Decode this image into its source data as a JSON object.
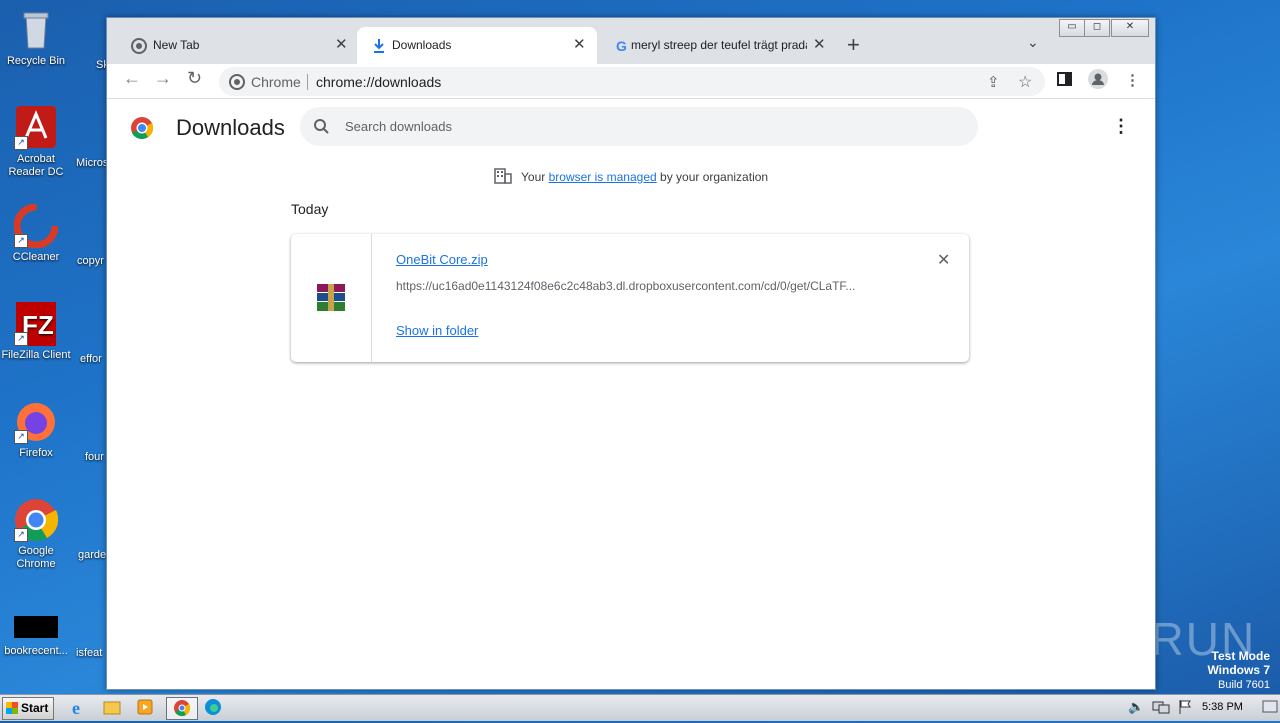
{
  "desktop": {
    "icons": [
      {
        "label": "Recycle Bin"
      },
      {
        "label": "Acrobat Reader DC"
      },
      {
        "label": "CCleaner"
      },
      {
        "label": "FileZilla Client"
      },
      {
        "label": "Firefox"
      },
      {
        "label": "Google Chrome"
      },
      {
        "label": "bookrecent..."
      }
    ],
    "cut_labels": [
      "Sk",
      "Micros",
      "copyr",
      "effor",
      "four",
      "garde",
      "isfeat"
    ]
  },
  "browser": {
    "tabs": [
      {
        "label": "New Tab",
        "icon": "chrome-icon"
      },
      {
        "label": "Downloads",
        "icon": "download-icon"
      },
      {
        "label": "meryl streep der teufel trägt prada -",
        "icon": "google-icon"
      }
    ],
    "omnibox": {
      "site": "Chrome",
      "url": "chrome://downloads"
    }
  },
  "downloads": {
    "title": "Downloads",
    "search_placeholder": "Search downloads",
    "managed": {
      "prefix": "Your",
      "link": "browser is managed",
      "suffix": "by your organization"
    },
    "date_header": "Today",
    "items": [
      {
        "filename": "OneBit Core.zip",
        "url": "https://uc16ad0e1143124f08e6c2c48ab3.dl.dropboxusercontent.com/cd/0/get/CLaTF...",
        "action": "Show in folder"
      }
    ]
  },
  "taskbar": {
    "start_label": "Start",
    "clock": "5:38 PM"
  },
  "watermark": {
    "brand": "ANY RUN",
    "line1": "Test Mode",
    "line2": "Windows 7",
    "line3": "Build 7601"
  }
}
